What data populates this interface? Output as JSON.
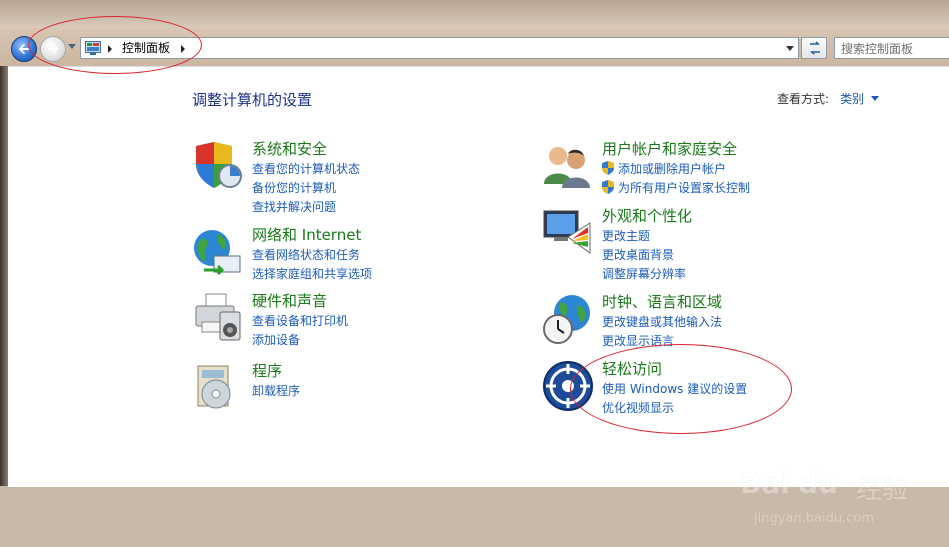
{
  "address": {
    "crumb": "控制面板",
    "search_placeholder": "搜索控制面板"
  },
  "header": {
    "title": "调整计算机的设置",
    "view_by_label": "查看方式:",
    "view_by_value": "类别"
  },
  "categories": [
    {
      "title": "系统和安全",
      "links": [
        "查看您的计算机状态",
        "备份您的计算机",
        "查找并解决问题"
      ]
    },
    {
      "title": "网络和 Internet",
      "links": [
        "查看网络状态和任务",
        "选择家庭组和共享选项"
      ]
    },
    {
      "title": "硬件和声音",
      "links": [
        "查看设备和打印机",
        "添加设备"
      ]
    },
    {
      "title": "程序",
      "links": [
        "卸载程序"
      ]
    },
    {
      "title": "用户帐户和家庭安全",
      "links": [
        "添加或删除用户帐户",
        "为所有用户设置家长控制"
      ]
    },
    {
      "title": "外观和个性化",
      "links": [
        "更改主题",
        "更改桌面背景",
        "调整屏幕分辨率"
      ]
    },
    {
      "title": "时钟、语言和区域",
      "links": [
        "更改键盘或其他输入法",
        "更改显示语言"
      ]
    },
    {
      "title": "轻松访问",
      "links": [
        "使用 Windows 建议的设置",
        "优化视频显示"
      ]
    }
  ],
  "watermark": {
    "brand": "Bai",
    "brand2": "du",
    "brand3": "经验",
    "url": "jingyan.baidu.com"
  },
  "colors": {
    "title_blue": "#1e3287",
    "category_green": "#1a7a1a",
    "link_blue": "#1c5db7",
    "annotation_red": "#d9232e"
  }
}
